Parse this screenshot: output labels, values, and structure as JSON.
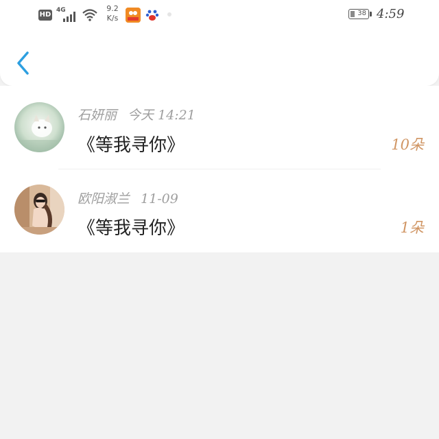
{
  "status_bar": {
    "hd_label": "HD",
    "network_label": "4G",
    "speed_value": "9.2",
    "speed_unit": "K/s",
    "time": "4:59",
    "battery_level": "38"
  },
  "header": {
    "back_icon": "chevron-left-icon"
  },
  "records": [
    {
      "name": "石妍丽",
      "date": "今天 14:21",
      "title": "《等我寻你》",
      "count": "10朵"
    },
    {
      "name": "欧阳淑兰",
      "date": "11-09",
      "title": "《等我寻你》",
      "count": "1朵"
    }
  ],
  "colors": {
    "accent": "#2d9fe0",
    "count": "#d09563",
    "meta": "#9e9e9e"
  }
}
